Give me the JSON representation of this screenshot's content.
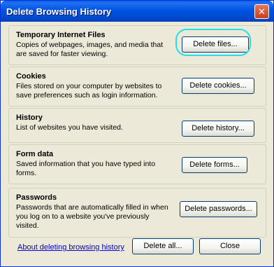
{
  "window": {
    "title": "Delete Browsing History",
    "close_glyph": "✕"
  },
  "sections": [
    {
      "title": "Temporary Internet Files",
      "description": "Copies of webpages, images, and media that are saved for faster viewing.",
      "button": "Delete files..."
    },
    {
      "title": "Cookies",
      "description": "Files stored on your computer by websites to save preferences such as login information.",
      "button": "Delete cookies..."
    },
    {
      "title": "History",
      "description": "List of websites you have visited.",
      "button": "Delete history..."
    },
    {
      "title": "Form data",
      "description": "Saved information that you have typed into forms.",
      "button": "Delete forms..."
    },
    {
      "title": "Passwords",
      "description": "Passwords that are automatically filled in when you log on to a website you've previously visited.",
      "button": "Delete passwords..."
    }
  ],
  "footer": {
    "link": "About deleting browsing history",
    "delete_all": "Delete all...",
    "close": "Close"
  },
  "colors": {
    "title_bar": "#0054e3",
    "highlight": "#21e0ea",
    "link": "#0000cc"
  }
}
